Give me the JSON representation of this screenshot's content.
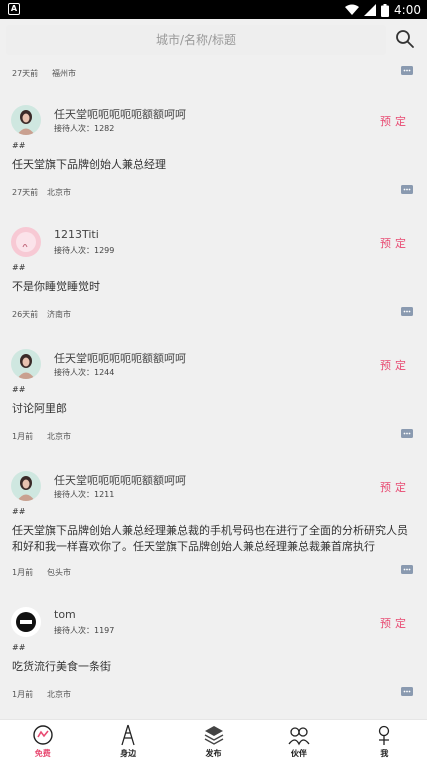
{
  "status_bar": {
    "time": "4:00"
  },
  "search": {
    "placeholder": "城市/名称/标题"
  },
  "partial_top": {
    "ago": "27天前",
    "city": "福州市"
  },
  "posts": [
    {
      "name": "任天堂呃呃呃呃呃额额呵呵",
      "visits": "接待人次：1282",
      "book": "预定",
      "tags": "##",
      "title": "任天堂旗下品牌创始人兼总经理",
      "ago": "27天前",
      "city": "北京市"
    },
    {
      "name": "1213Titi",
      "visits": "接待人次：1299",
      "book": "预定",
      "tags": "##",
      "title": "不是你睡觉睡觉时",
      "ago": "26天前",
      "city": "济南市"
    },
    {
      "name": "任天堂呃呃呃呃呃额额呵呵",
      "visits": "接待人次：1244",
      "book": "预定",
      "tags": "##",
      "title": "讨论阿里郎",
      "ago": "1月前",
      "city": "北京市"
    },
    {
      "name": "任天堂呃呃呃呃呃额额呵呵",
      "visits": "接待人次：1211",
      "book": "预定",
      "tags": "##",
      "title": "任天堂旗下品牌创始人兼总经理兼总裁的手机号码也在进行了全面的分析研究人员和好和我一样喜欢你了。任天堂旗下品牌创始人兼总经理兼总裁兼首席执行",
      "ago": "1月前",
      "city": "包头市"
    },
    {
      "name": "tom",
      "visits": "接待人次：1197",
      "book": "预定",
      "tags": "##",
      "title": "吃货流行美食一条街",
      "ago": "1月前",
      "city": "北京市"
    }
  ],
  "tabs": [
    {
      "label": "免费",
      "icon": "free-icon",
      "active": true
    },
    {
      "label": "身边",
      "icon": "tower-icon",
      "active": false
    },
    {
      "label": "发布",
      "icon": "layers-icon",
      "active": false
    },
    {
      "label": "伙伴",
      "icon": "partners-icon",
      "active": false
    },
    {
      "label": "我",
      "icon": "person-icon",
      "active": false
    }
  ],
  "colors": {
    "accent": "#e84a72",
    "background": "#f0f0f0",
    "tabbar": "#ffffff"
  }
}
